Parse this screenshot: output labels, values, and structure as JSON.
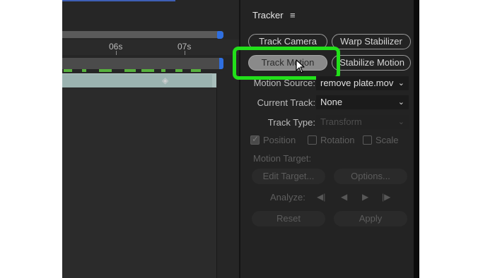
{
  "timeline": {
    "ticks": [
      "06s",
      "07s"
    ]
  },
  "panel": {
    "title": "Tracker",
    "menu_icon": "hamburger-menu-icon",
    "buttons": {
      "track_camera": "Track Camera",
      "warp_stabilizer": "Warp Stabilizer",
      "track_motion": "Track Motion",
      "stabilize_motion": "Stabilize Motion"
    },
    "motion_source": {
      "label": "Motion Source:",
      "value": "remove plate.mov"
    },
    "current_track": {
      "label": "Current Track:",
      "value": "None"
    },
    "track_type": {
      "label": "Track Type:",
      "value": "Transform"
    },
    "checkboxes": [
      {
        "label": "Position",
        "checked": true
      },
      {
        "label": "Rotation",
        "checked": false
      },
      {
        "label": "Scale",
        "checked": false
      }
    ],
    "motion_target_label": "Motion Target:",
    "edit_target": "Edit Target...",
    "options": "Options...",
    "analyze_label": "Analyze:",
    "reset": "Reset",
    "apply": "Apply"
  },
  "colors": {
    "highlight": "#22e01a",
    "keyframes": "#57b13d",
    "accent_blue": "#2f6fe0"
  }
}
